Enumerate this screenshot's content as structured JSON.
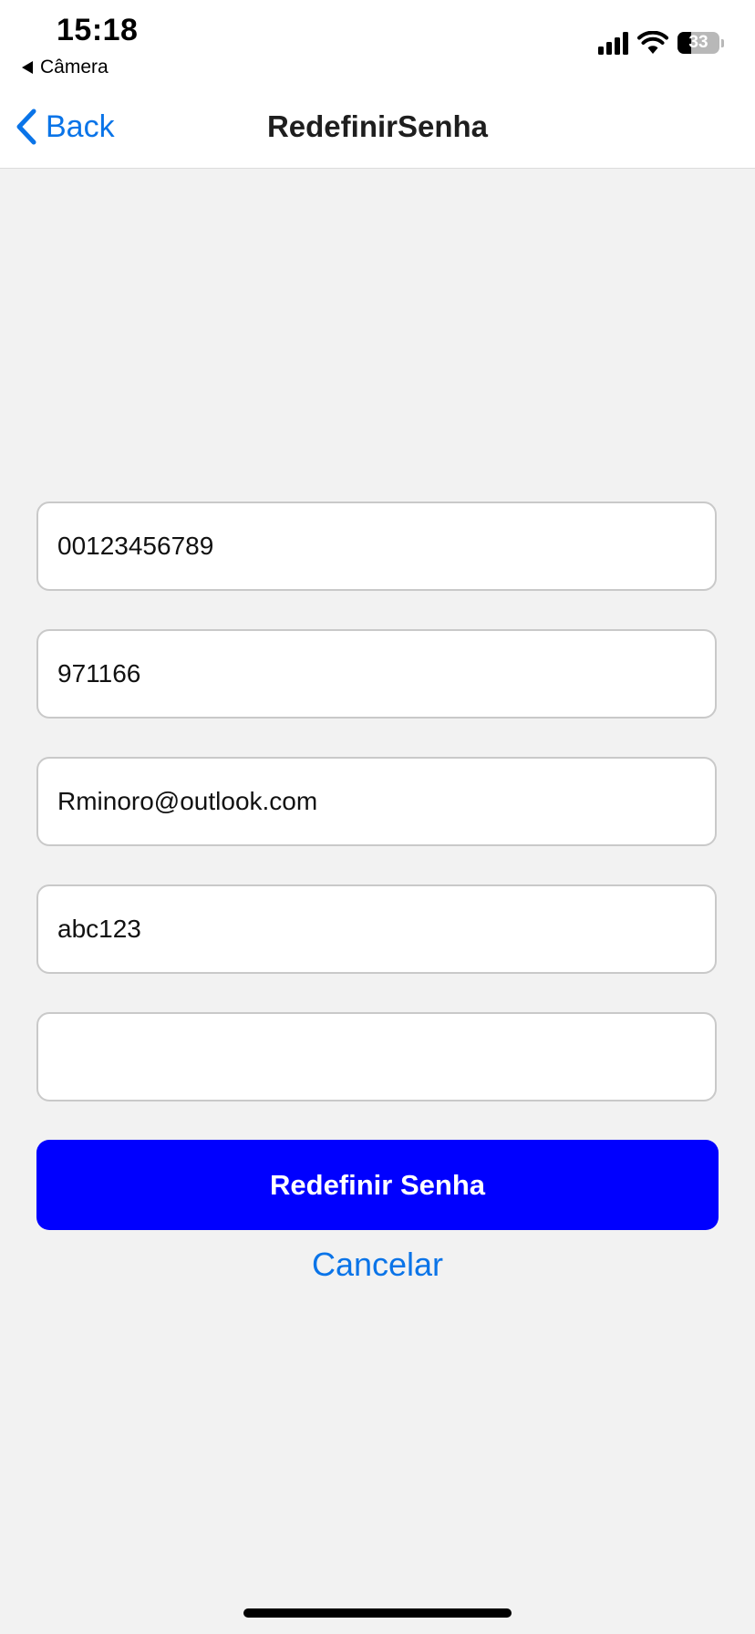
{
  "status_bar": {
    "time": "15:18",
    "back_app": "Câmera",
    "battery_percent": "33",
    "battery_level": 0.33
  },
  "nav": {
    "back_label": "Back",
    "title": "RedefinirSenha"
  },
  "form": {
    "field1_value": "00123456789",
    "field2_value": "971166",
    "field3_value": "Rminoro@outlook.com",
    "field4_value": "abc123",
    "field5_value": ""
  },
  "actions": {
    "submit_label": "Redefinir Senha",
    "cancel_label": "Cancelar"
  },
  "colors": {
    "accent": "#0a74e8",
    "primary_button": "#0000ff",
    "background": "#f2f2f2"
  }
}
